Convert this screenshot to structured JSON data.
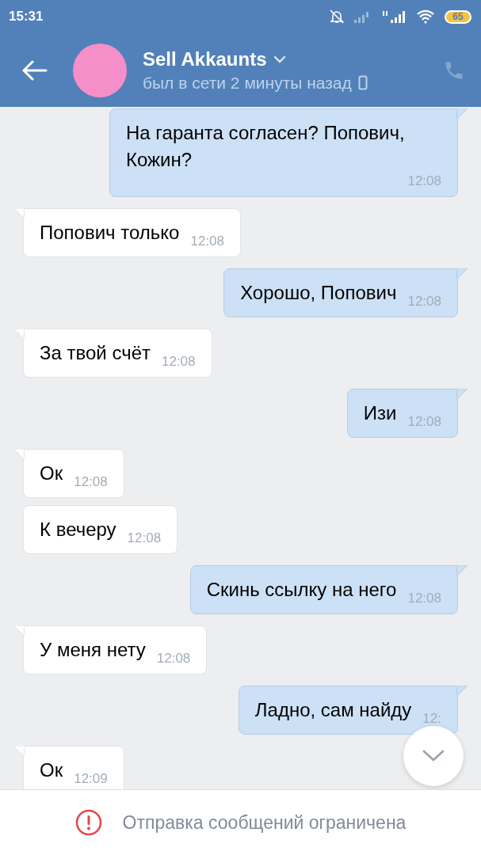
{
  "status_bar": {
    "time": "15:31",
    "battery": "65"
  },
  "header": {
    "title": "Sell Akkaunts",
    "subtitle": "был в сети 2 минуты назад"
  },
  "messages": [
    {
      "kind": "outgoing",
      "text": "На гаранта согласен? Попович, Кожин?",
      "time": "12:08",
      "tail": true
    },
    {
      "kind": "incoming",
      "text": "Попович только",
      "time": "12:08",
      "tail": true
    },
    {
      "kind": "outgoing",
      "text": "Хорошо, Попович",
      "time": "12:08",
      "tail": true
    },
    {
      "kind": "incoming",
      "text": "За твой счёт",
      "time": "12:08",
      "tail": true
    },
    {
      "kind": "outgoing",
      "text": "Изи",
      "time": "12:08",
      "tail": true
    },
    {
      "kind": "incoming",
      "text": "Ок",
      "time": "12:08",
      "tail": true
    },
    {
      "kind": "incoming",
      "text": "К вечеру",
      "time": "12:08",
      "tail": false
    },
    {
      "kind": "outgoing",
      "text": "Скинь ссылку на него",
      "time": "12:08",
      "tail": true
    },
    {
      "kind": "incoming",
      "text": "У меня нету",
      "time": "12:08",
      "tail": true
    },
    {
      "kind": "outgoing",
      "text": "Ладно, сам найду",
      "time": "12:",
      "tail": true
    },
    {
      "kind": "incoming",
      "text": "Ок",
      "time": "12:09",
      "tail": true
    }
  ],
  "footer": {
    "notice": "Отправка сообщений ограничена"
  }
}
